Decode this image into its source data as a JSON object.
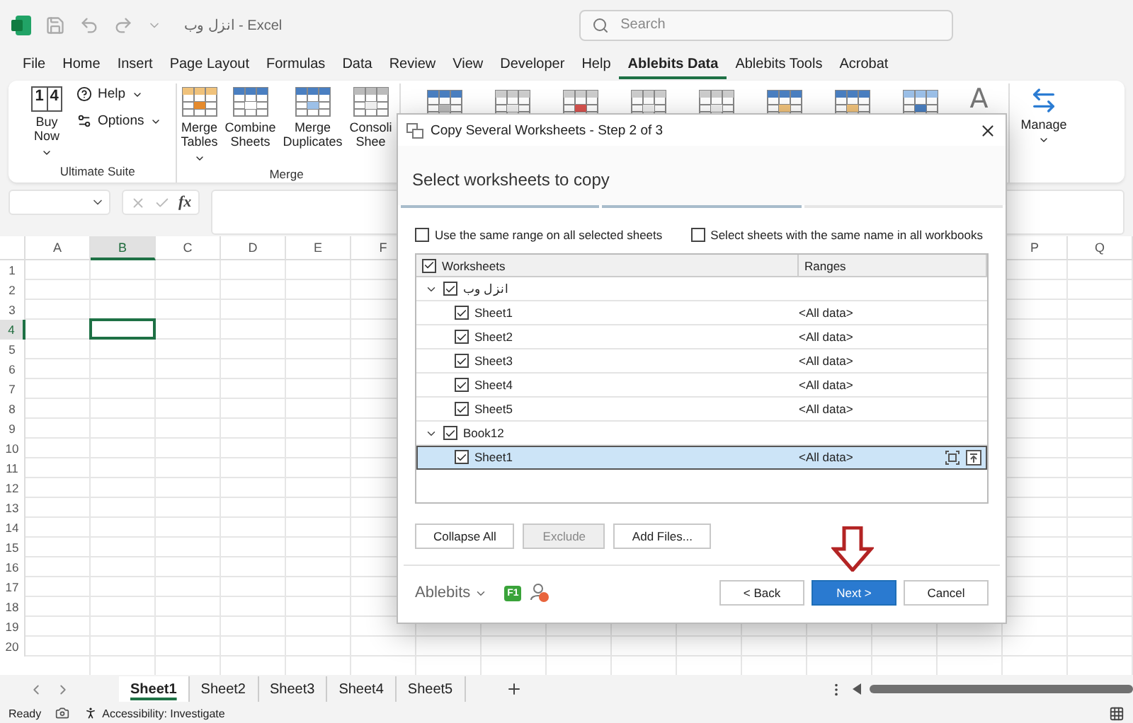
{
  "window": {
    "title": "انزل وب - Excel",
    "search_placeholder": "Search"
  },
  "menu_tabs": [
    {
      "label": "File",
      "selected": false
    },
    {
      "label": "Home",
      "selected": false
    },
    {
      "label": "Insert",
      "selected": false
    },
    {
      "label": "Page Layout",
      "selected": false
    },
    {
      "label": "Formulas",
      "selected": false
    },
    {
      "label": "Data",
      "selected": false
    },
    {
      "label": "Review",
      "selected": false
    },
    {
      "label": "View",
      "selected": false
    },
    {
      "label": "Developer",
      "selected": false
    },
    {
      "label": "Help",
      "selected": false
    },
    {
      "label": "Ablebits Data",
      "selected": true
    },
    {
      "label": "Ablebits Tools",
      "selected": false
    },
    {
      "label": "Acrobat",
      "selected": false
    }
  ],
  "ribbon": {
    "buy": {
      "logo": [
        "1",
        "4"
      ],
      "label": "Buy Now",
      "dropdown": true
    },
    "small_buttons": [
      {
        "label": "Help",
        "dropdown": true
      },
      {
        "label": "Options",
        "dropdown": true
      }
    ],
    "group_1": "Ultimate Suite",
    "merge_buttons": [
      {
        "label": "Merge Tables",
        "dropdown": true
      },
      {
        "label": "Combine Sheets",
        "dropdown": false
      },
      {
        "label": "Merge Duplicates",
        "dropdown": false
      },
      {
        "label": "Consoli Shee",
        "dropdown": false
      }
    ],
    "group_2": "Merge",
    "letter_icon": "A",
    "manage": {
      "label": "Manage",
      "dropdown": true
    }
  },
  "formula_bar": {
    "fx": "fx"
  },
  "sheet": {
    "columns_left": [
      {
        "label": "A",
        "selected": false
      },
      {
        "label": "B",
        "selected": true
      },
      {
        "label": "C",
        "selected": false
      },
      {
        "label": "D",
        "selected": false
      },
      {
        "label": "E",
        "selected": false
      },
      {
        "label": "F",
        "selected": false
      }
    ],
    "columns_right": [
      {
        "label": "P",
        "selected": false
      },
      {
        "label": "Q",
        "selected": false
      }
    ],
    "rows": [
      {
        "label": "1",
        "selected": false
      },
      {
        "label": "2",
        "selected": false
      },
      {
        "label": "3",
        "selected": false
      },
      {
        "label": "4",
        "selected": true
      },
      {
        "label": "5",
        "selected": false
      },
      {
        "label": "6",
        "selected": false
      },
      {
        "label": "7",
        "selected": false
      },
      {
        "label": "8",
        "selected": false
      },
      {
        "label": "9",
        "selected": false
      },
      {
        "label": "10",
        "selected": false
      },
      {
        "label": "11",
        "selected": false
      },
      {
        "label": "12",
        "selected": false
      },
      {
        "label": "13",
        "selected": false
      },
      {
        "label": "14",
        "selected": false
      },
      {
        "label": "15",
        "selected": false
      },
      {
        "label": "16",
        "selected": false
      },
      {
        "label": "17",
        "selected": false
      },
      {
        "label": "18",
        "selected": false
      },
      {
        "label": "19",
        "selected": false
      },
      {
        "label": "20",
        "selected": false
      }
    ]
  },
  "sheet_tabs": [
    {
      "label": "Sheet1",
      "selected": true
    },
    {
      "label": "Sheet2",
      "selected": false
    },
    {
      "label": "Sheet3",
      "selected": false
    },
    {
      "label": "Sheet4",
      "selected": false
    },
    {
      "label": "Sheet5",
      "selected": false
    }
  ],
  "status_bar": {
    "ready": "Ready",
    "accessibility": "Accessibility: Investigate"
  },
  "dialog": {
    "title": "Copy Several Worksheets - Step 2 of 3",
    "heading": "Select worksheets to copy",
    "steps": [
      {
        "done": true
      },
      {
        "done": true
      },
      {
        "done": false
      }
    ],
    "options": [
      {
        "label": "Use the same range on all selected sheets",
        "checked": false
      },
      {
        "label": "Select sheets with the same name in all workbooks",
        "checked": false
      }
    ],
    "tree": {
      "header": {
        "label": "Worksheets",
        "checked": true
      },
      "ranges_header": "Ranges",
      "workbooks": [
        {
          "name": "انزل وب",
          "expanded": true,
          "checked": true,
          "selected": false,
          "children": [
            {
              "name": "Sheet1",
              "range": "<All data>",
              "checked": true,
              "selected": false
            },
            {
              "name": "Sheet2",
              "range": "<All data>",
              "checked": true,
              "selected": false
            },
            {
              "name": "Sheet3",
              "range": "<All data>",
              "checked": true,
              "selected": false
            },
            {
              "name": "Sheet4",
              "range": "<All data>",
              "checked": true,
              "selected": false
            },
            {
              "name": "Sheet5",
              "range": "<All data>",
              "checked": true,
              "selected": false
            }
          ]
        },
        {
          "name": "Book12",
          "expanded": true,
          "checked": true,
          "selected": false,
          "children": [
            {
              "name": "Sheet1",
              "range": "<All data>",
              "checked": true,
              "selected": true
            }
          ]
        }
      ]
    },
    "tree_buttons": [
      {
        "label": "Collapse All",
        "disabled": false
      },
      {
        "label": "Exclude",
        "disabled": true
      },
      {
        "label": "Add Files...",
        "disabled": false
      }
    ],
    "brand": "Ablebits",
    "f1": "F1",
    "nav_buttons": [
      {
        "label": "< Back",
        "primary": false
      },
      {
        "label": "Next >",
        "primary": true
      },
      {
        "label": "Cancel",
        "primary": false
      }
    ]
  }
}
